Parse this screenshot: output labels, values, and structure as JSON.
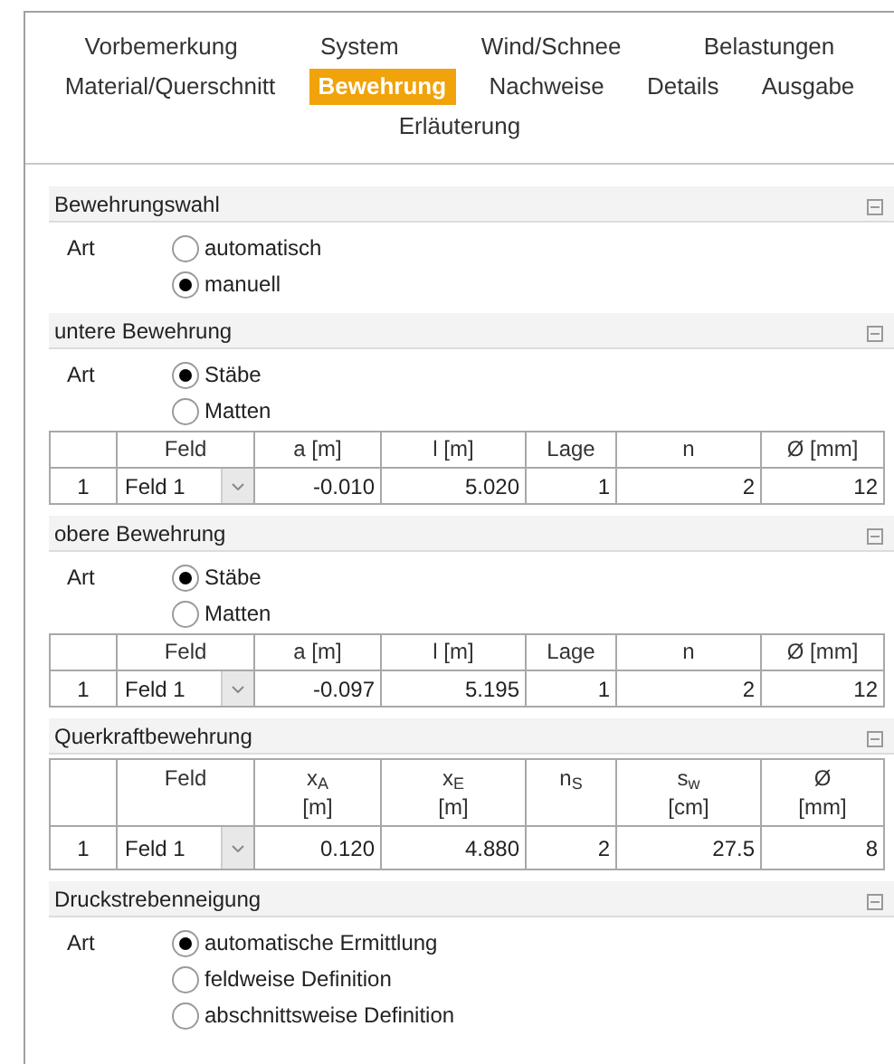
{
  "tab_rows": [
    [
      {
        "label": "Vorbemerkung",
        "selected": false
      },
      {
        "label": "System",
        "selected": false
      },
      {
        "label": "Wind/Schnee",
        "selected": false
      },
      {
        "label": "Belastungen",
        "selected": false
      }
    ],
    [
      {
        "label": "Material/Querschnitt",
        "selected": false
      },
      {
        "label": "Bewehrung",
        "selected": true
      },
      {
        "label": "Nachweise",
        "selected": false
      },
      {
        "label": "Details",
        "selected": false
      },
      {
        "label": "Ausgabe",
        "selected": false
      }
    ],
    [
      {
        "label": "Erläuterung",
        "selected": false
      }
    ]
  ],
  "sections": [
    {
      "title": "Bewehrungswahl",
      "expanded": true,
      "radio_group": {
        "label": "Art",
        "options": [
          {
            "label": "automatisch",
            "selected": false
          },
          {
            "label": "manuell",
            "selected": true
          }
        ]
      }
    },
    {
      "title": "untere Bewehrung",
      "expanded": true,
      "radio_group": {
        "label": "Art",
        "options": [
          {
            "label": "Stäbe",
            "selected": true
          },
          {
            "label": "Matten",
            "selected": false
          }
        ]
      },
      "table": {
        "columns": [
          [
            "Feld"
          ],
          [
            "a [m]"
          ],
          [
            "l [m]"
          ],
          [
            "Lage"
          ],
          [
            "n"
          ],
          [
            "Ø [mm]"
          ]
        ],
        "rows": [
          {
            "index": "1",
            "feld": "Feld 1",
            "values": [
              "-0.010",
              "5.020",
              "1",
              "2",
              "12"
            ]
          }
        ]
      }
    },
    {
      "title": "obere Bewehrung",
      "expanded": true,
      "radio_group": {
        "label": "Art",
        "options": [
          {
            "label": "Stäbe",
            "selected": true
          },
          {
            "label": "Matten",
            "selected": false
          }
        ]
      },
      "table": {
        "columns": [
          [
            "Feld"
          ],
          [
            "a [m]"
          ],
          [
            "l [m]"
          ],
          [
            "Lage"
          ],
          [
            "n"
          ],
          [
            "Ø [mm]"
          ]
        ],
        "rows": [
          {
            "index": "1",
            "feld": "Feld 1",
            "values": [
              "-0.097",
              "5.195",
              "1",
              "2",
              "12"
            ]
          }
        ]
      }
    },
    {
      "title": "Querkraftbewehrung",
      "expanded": true,
      "table": {
        "columns": [
          [
            "Feld"
          ],
          [
            "x$_{A}$",
            "[m]"
          ],
          [
            "x$_{E}$",
            "[m]"
          ],
          [
            "n$_{S}$"
          ],
          [
            "s$_{w}$",
            "[cm]"
          ],
          [
            "Ø",
            "[mm]"
          ]
        ],
        "rows": [
          {
            "index": "1",
            "feld": "Feld 1",
            "values": [
              "0.120",
              "4.880",
              "2",
              "27.5",
              "8"
            ]
          }
        ]
      }
    },
    {
      "title": "Druckstrebenneigung",
      "expanded": true,
      "radio_group": {
        "label": "Art",
        "options": [
          {
            "label": "automatische Ermittlung",
            "selected": true
          },
          {
            "label": "feldweise Definition",
            "selected": false
          },
          {
            "label": "abschnittsweise Definition",
            "selected": false
          }
        ]
      }
    }
  ]
}
